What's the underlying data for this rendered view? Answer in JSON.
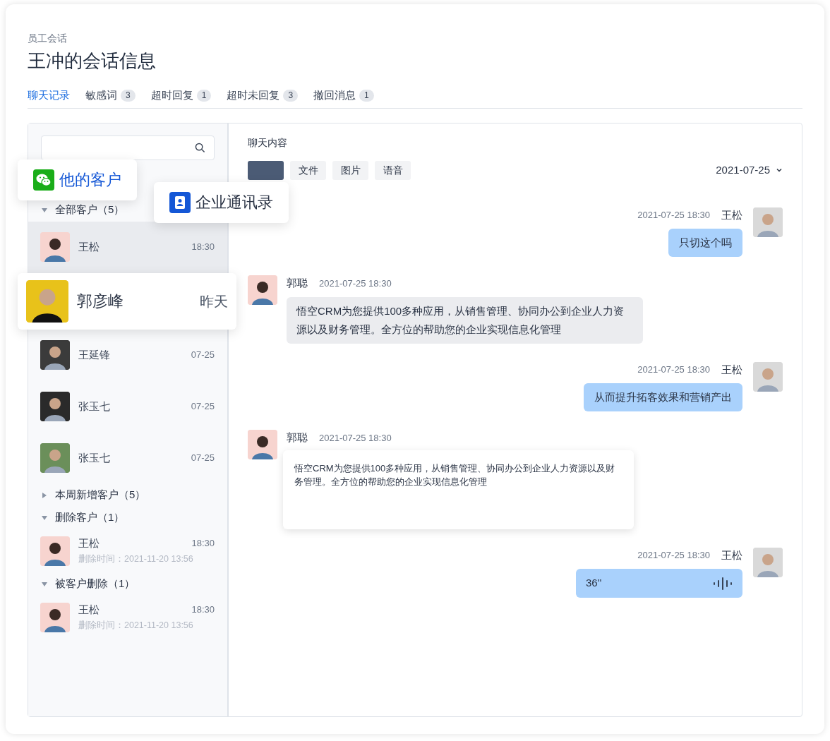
{
  "header": {
    "breadcrumb": "员工会话",
    "title": "王冲的会话信息"
  },
  "tabs": [
    {
      "label": "聊天记录",
      "selected": true
    },
    {
      "label": "敏感词",
      "count": "3",
      "selected": false
    },
    {
      "label": "超时回复",
      "count": "1",
      "selected": false
    },
    {
      "label": "超时未回复",
      "count": "3",
      "selected": false
    },
    {
      "label": "撤回消息",
      "count": "1",
      "selected": false
    }
  ],
  "sidebar": {
    "tabs": [
      {
        "label": "他的客户",
        "selected": true
      },
      {
        "label": "企业通讯录",
        "selected": false
      }
    ],
    "groups": [
      {
        "label": "全部客户（5）",
        "expanded": true,
        "contacts": [
          {
            "name": "王松",
            "time": "18:30",
            "selected": true
          },
          {
            "name": "郭彦峰",
            "time": "昨天",
            "selected": false,
            "kind": "popout"
          },
          {
            "name": "王延锋",
            "time": "07-25",
            "selected": false
          },
          {
            "name": "张玉七",
            "time": "07-25",
            "selected": false
          },
          {
            "name": "张玉七",
            "time": "07-25",
            "selected": false
          }
        ]
      },
      {
        "label": "本周新增客户（5）",
        "expanded": false
      },
      {
        "label": "删除客户（1）",
        "expanded": true,
        "contacts": [
          {
            "name": "王松",
            "time": "18:30",
            "deleted": "删除时间：2021-11-20  13:56",
            "selected": false
          }
        ]
      },
      {
        "label": "被客户删除（1）",
        "expanded": true,
        "contacts": [
          {
            "name": "王松",
            "time": "18:30",
            "deleted": "删除时间：2021-11-20  13:56",
            "selected": false
          }
        ]
      }
    ]
  },
  "chat": {
    "title": "聊天内容",
    "filters": [
      {
        "selected": true
      },
      {
        "label": "文件",
        "selected": false
      },
      {
        "label": "图片",
        "selected": false
      },
      {
        "label": "语音",
        "selected": false
      }
    ],
    "date": "2021-07-25",
    "messages": [
      {
        "kind": "sent",
        "name": "王松",
        "time": "2021-07-25  18:30",
        "content": {
          "kind": "text",
          "text": "只切这个吗"
        }
      },
      {
        "kind": "received",
        "name": "郭聪",
        "time": "2021-07-25  18:30",
        "content": {
          "kind": "text",
          "text": "悟空CRM为您提供100多种应用，从销售管理、协同办公到企业人力资源以及财务管理。全方位的帮助您的企业实现信息化管理"
        }
      },
      {
        "kind": "sent",
        "name": "王松",
        "time": "2021-07-25  18:30",
        "content": {
          "kind": "text",
          "text": "从而提升拓客效果和营销产出"
        }
      },
      {
        "kind": "received",
        "name": "郭聪",
        "time": "2021-07-25  18:30",
        "content": {
          "kind": "card",
          "text": "悟空CRM为您提供100多种应用，从销售管理、协同办公到企业人力资源以及财务管理。全方位的帮助您的企业实现信息化管理"
        }
      },
      {
        "kind": "sent",
        "name": "王松",
        "time": "2021-07-25  18:30",
        "content": {
          "kind": "voice",
          "text": "36''"
        }
      }
    ]
  }
}
